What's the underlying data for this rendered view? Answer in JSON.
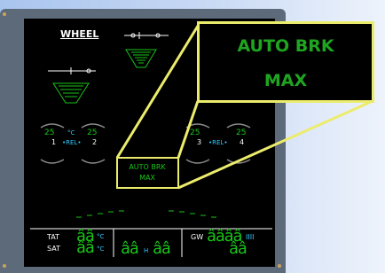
{
  "title": "WHEEL",
  "left_brake": {
    "temp": "25",
    "unit": "°C",
    "right_temp": "25",
    "wheel_left": "1",
    "rel": "•REL•",
    "wheel_right": "2"
  },
  "right_brake": {
    "temp": "25",
    "right_temp": "25",
    "wheel_left": "3",
    "rel": "•REL•",
    "wheel_right": "4"
  },
  "autobrk": {
    "line1": "AUTO BRK",
    "line2": "MAX"
  },
  "callout": {
    "line1": "AUTO BRK",
    "line2": "MAX"
  },
  "bottom": {
    "tat_label": "TAT",
    "sat_label": "SAT",
    "tat_value": "ââ",
    "sat_value": "ââ",
    "deg_unit_1": "°C",
    "deg_unit_2": "°C",
    "hours_value": "ââ",
    "h_label": "H",
    "minutes_value": "ââ",
    "gw_label": "GW",
    "gw_value": "ââââ",
    "gw_unit": "IIII",
    "gw_value2": "ââ"
  },
  "colors": {
    "green": "#18c418",
    "cyan": "#2ec8ff",
    "white": "#ffffff",
    "callout_border": "#ecec6c"
  }
}
